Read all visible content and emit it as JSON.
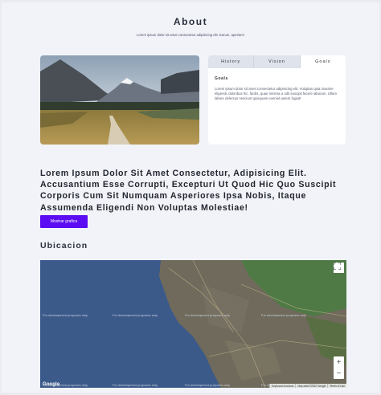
{
  "about": {
    "title": "About",
    "subtitle": "Lorem ipsum dolor sit amet consectetur adipisicing elit. Earum, aperiam!"
  },
  "tabs": {
    "items": [
      {
        "label": "History",
        "active": false
      },
      {
        "label": "Vision",
        "active": false
      },
      {
        "label": "Goals",
        "active": true
      }
    ],
    "panel": {
      "heading": "Goals",
      "text": "Lorem ipsum dolor sit amet consectetur adipisicing elit. Voluptas quia maxime eligendi, doloribus hic, facilis, quae minima a odit suscipit facere laborum. Ullam labore delectus nesciunt quisquam eveniet autem fugiat!"
    }
  },
  "headline": "Lorem Ipsum Dolor Sit Amet Consectetur, Adipisicing Elit. Accusantium Esse Corrupti, Excepturi Ut Quod Hic Quo Suscipit Corporis Cum Sit Numquam Asperiores Ipsa Nobis, Itaque Assumenda Eligendi Non Voluptas Molestiae!",
  "button": {
    "label": "Mostrar grafica"
  },
  "location": {
    "title": "Ubicacion",
    "dev_notice": "For development purposes only",
    "footer": [
      "Keyboard shortcuts",
      "Map data ©2022 Google",
      "Terms of Use"
    ],
    "google_logo": "Google",
    "zoom_in": "+",
    "zoom_out": "−"
  },
  "colors": {
    "accent": "#5b0cf2",
    "page_bg": "#f1f3f8",
    "ocean": "#3b5a8a"
  }
}
